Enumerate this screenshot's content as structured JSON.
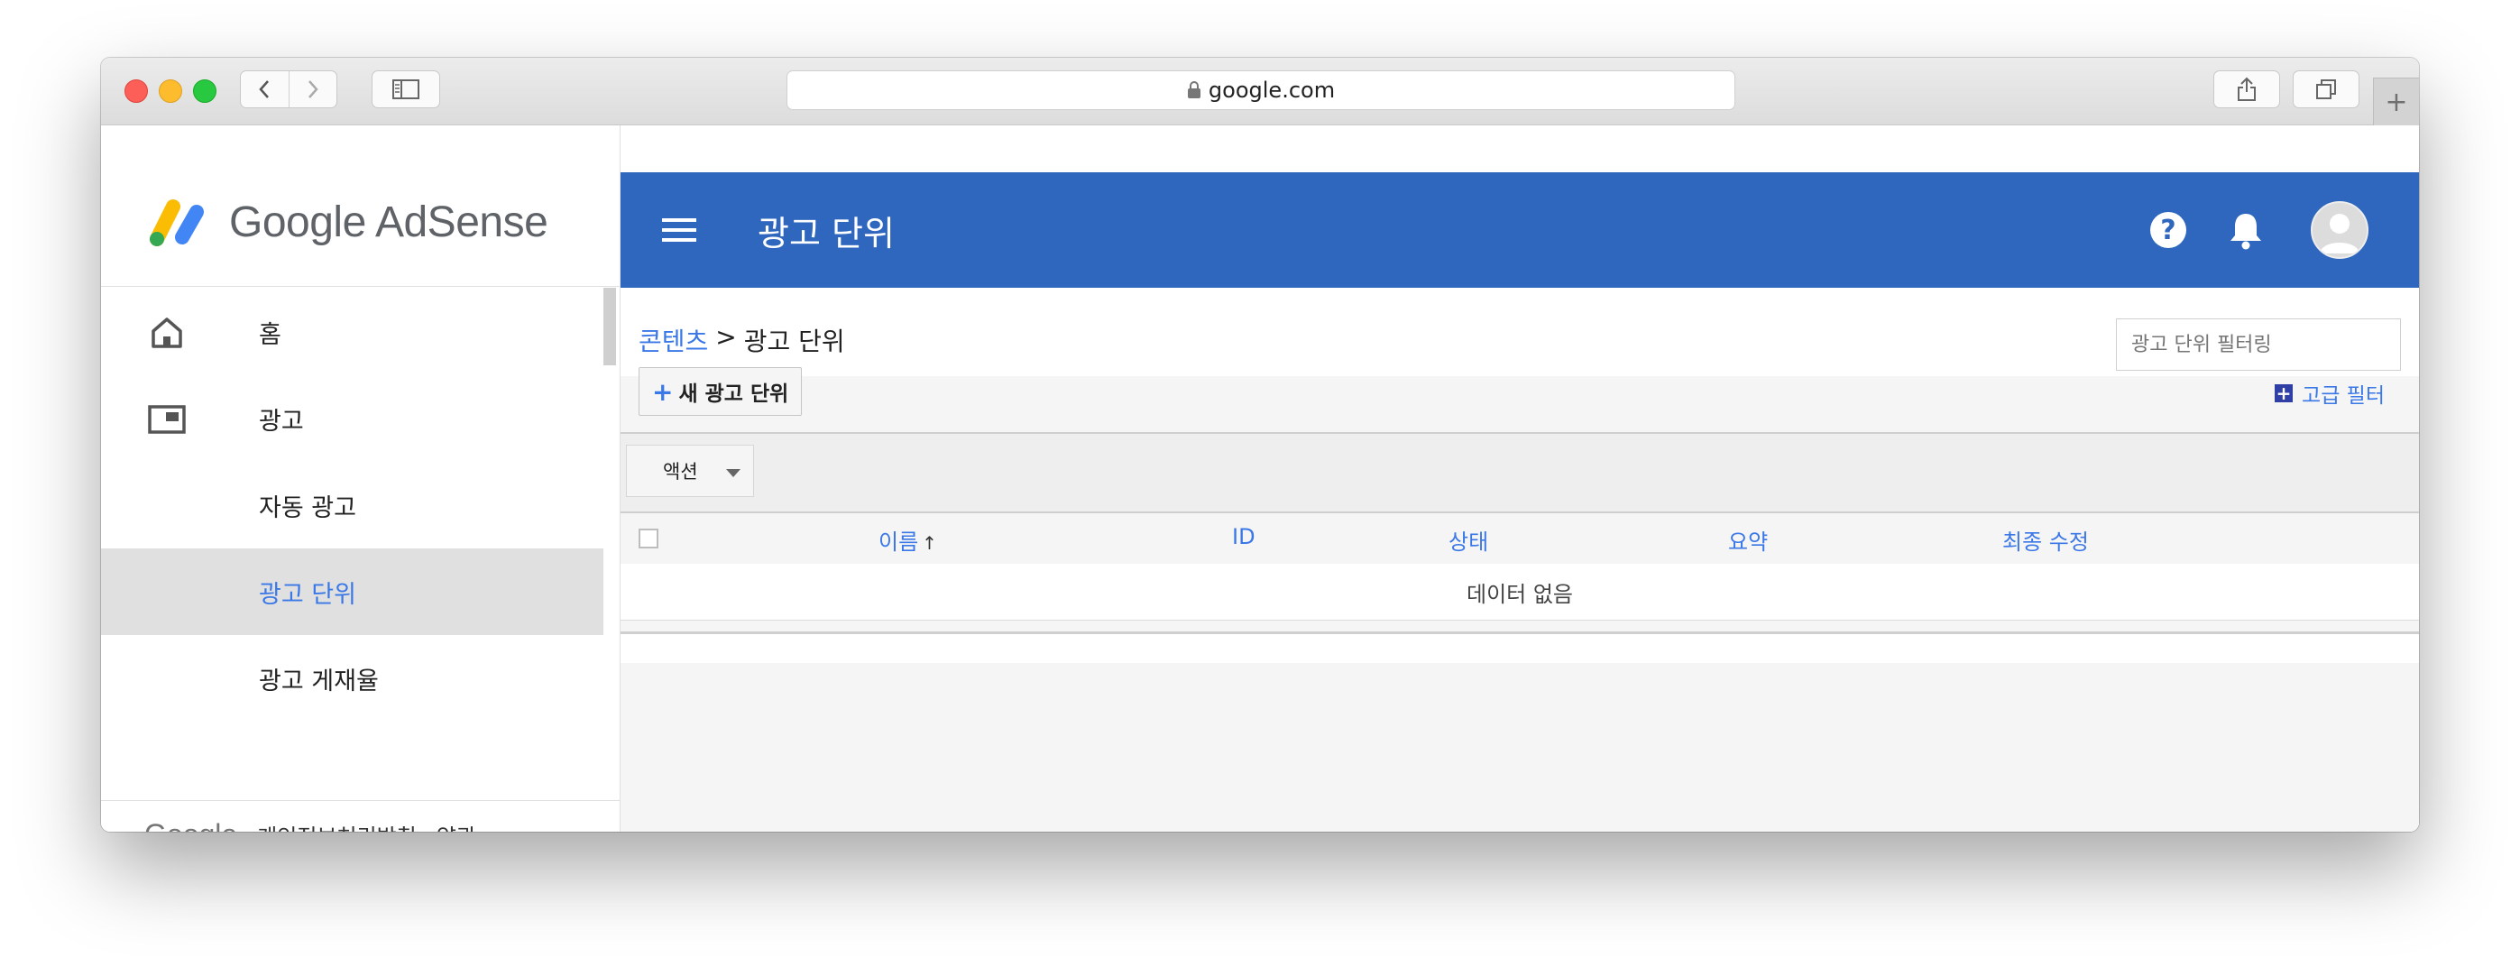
{
  "browser": {
    "url": "google.com"
  },
  "brand": {
    "name": "Google AdSense"
  },
  "nav": {
    "items": [
      {
        "label": "홈"
      },
      {
        "label": "광고"
      },
      {
        "label": "자동 광고"
      },
      {
        "label": "광고 단위"
      },
      {
        "label": "광고 게재율"
      }
    ]
  },
  "footer": {
    "google": "Google",
    "privacy": "개인정보처리방침",
    "terms": "약관"
  },
  "appbar": {
    "title": "광고 단위"
  },
  "breadcrumb": {
    "parent": "콘텐츠",
    "separator": ">",
    "current": "광고 단위"
  },
  "toolbar": {
    "new_label": "새 광고 단위",
    "action_label": "액션",
    "filter_placeholder": "광고 단위 필터링",
    "advanced_filter": "고급 필터"
  },
  "table": {
    "columns": [
      "이름",
      "ID",
      "상태",
      "요약",
      "최종 수정"
    ],
    "sort_indicator": "🡡",
    "empty": "데이터 없음"
  },
  "colors": {
    "appbar": "#2f67bf",
    "link": "#3b78e7"
  }
}
